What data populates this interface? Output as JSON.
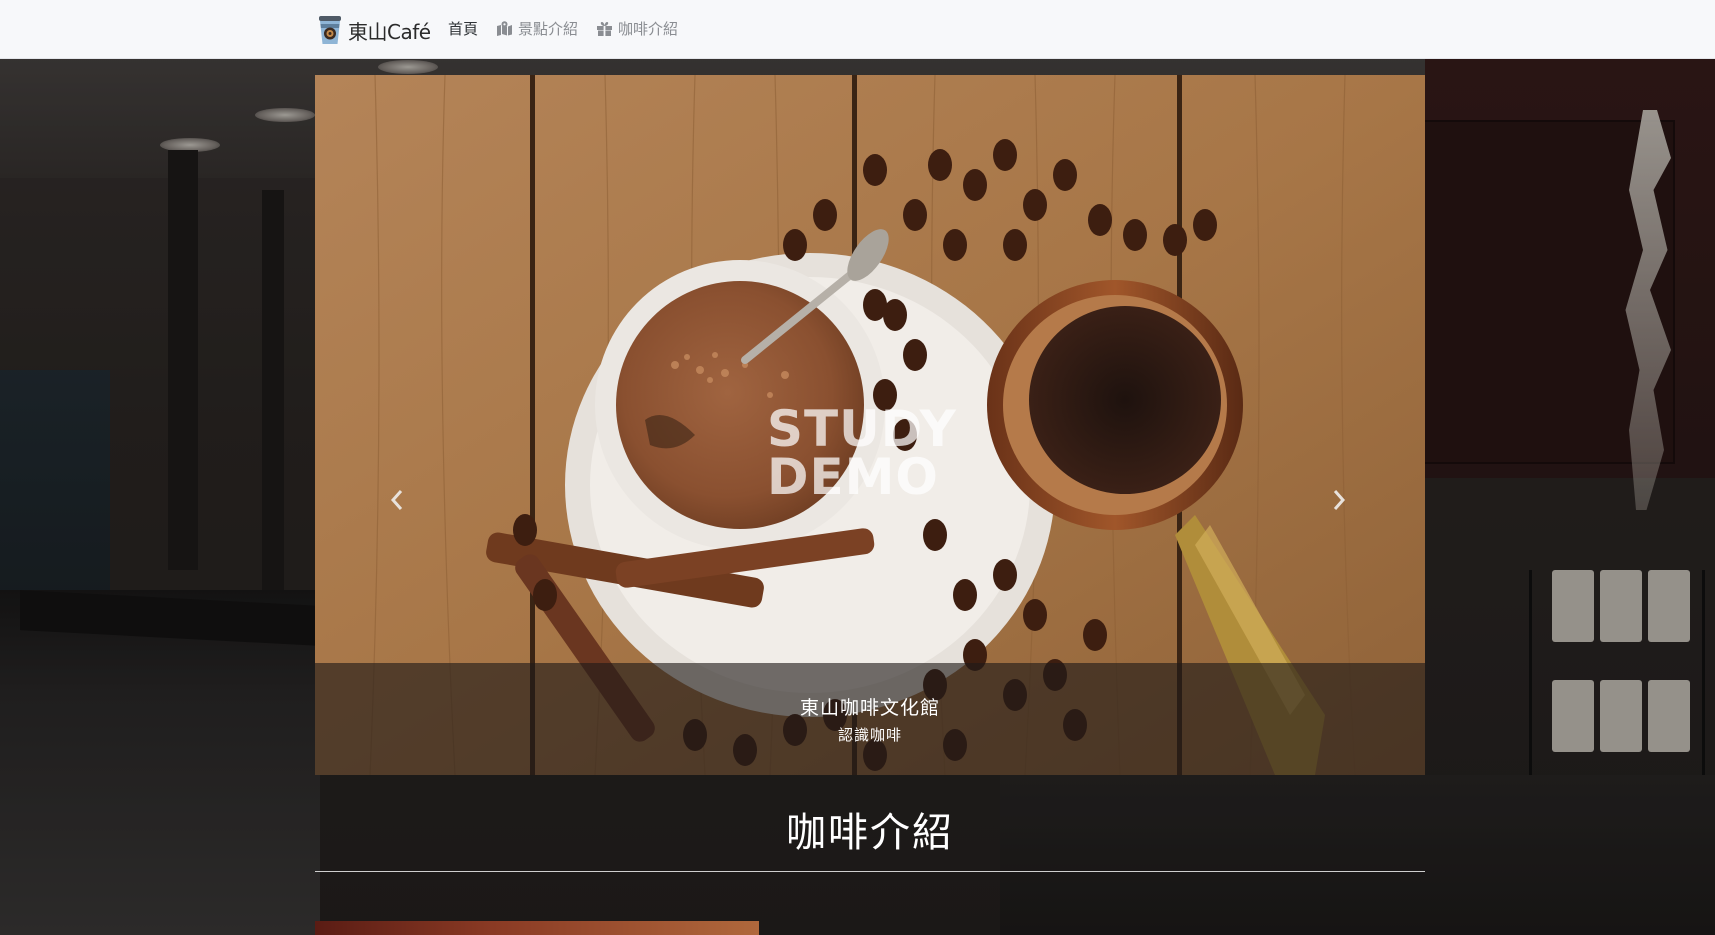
{
  "navbar": {
    "brand_label": "東山Café",
    "brand_icon": "coffee-cup-icon",
    "links": [
      {
        "label": "首頁",
        "icon": "",
        "active": true
      },
      {
        "label": "景點介紹",
        "icon": "map-icon",
        "active": false
      },
      {
        "label": "咖啡介紹",
        "icon": "gift-icon",
        "active": false
      }
    ]
  },
  "carousel": {
    "watermark_line1": "STUDY",
    "watermark_line2": "DEMO",
    "caption_title": "東山咖啡文化館",
    "caption_subtitle": "認識咖啡",
    "prev_icon": "chevron-left-icon",
    "next_icon": "chevron-right-icon"
  },
  "section": {
    "title": "咖啡介紹"
  },
  "colors": {
    "navbar_bg": "#f7f8fa",
    "nav_text_active": "#2f3337",
    "nav_text": "#8a8d92",
    "caption_overlay": "rgba(30,26,24,0.62)",
    "heading_text": "#ffffff"
  }
}
